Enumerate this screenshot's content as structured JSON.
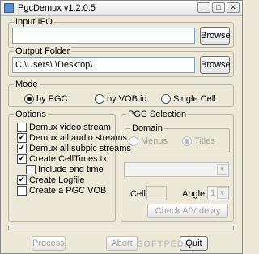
{
  "window": {
    "title": "PgcDemux v1.2.0.5"
  },
  "titlebar_buttons": {
    "minimize": "_",
    "maximize": "□",
    "close": "✕"
  },
  "input_ifo": {
    "label": "Input IFO",
    "value": "",
    "browse": "Browse"
  },
  "output_folder": {
    "label": "Output Folder",
    "value": "C:\\Users\\     \\Desktop\\     ",
    "browse": "Browse"
  },
  "mode": {
    "label": "Mode",
    "options": [
      {
        "label": "by PGC",
        "checked": true
      },
      {
        "label": "by VOB id",
        "checked": false
      },
      {
        "label": "Single Cell",
        "checked": false
      }
    ]
  },
  "options": {
    "label": "Options",
    "items": [
      {
        "label": "Demux video stream",
        "checked": false
      },
      {
        "label": "Demux all audio streams",
        "checked": true
      },
      {
        "label": "Demux all subpic streams",
        "checked": true
      },
      {
        "label": "Create CellTimes.txt",
        "checked": true
      },
      {
        "label": "Include end time",
        "checked": false
      },
      {
        "label": "Create Logfile",
        "checked": true
      },
      {
        "label": "Create a PGC VOB",
        "checked": false
      }
    ]
  },
  "pgc_selection": {
    "label": "PGC Selection",
    "domain": {
      "label": "Domain",
      "menus": "Menus",
      "titles": "Titles"
    },
    "cells_label": "Cells",
    "angle_label": "Angle",
    "angle_value": "1",
    "check_av": "Check A/V delay"
  },
  "bottom": {
    "process": "Process!",
    "abort": "Abort",
    "quit": "Quit"
  },
  "watermark": "SOFTPEDIA"
}
